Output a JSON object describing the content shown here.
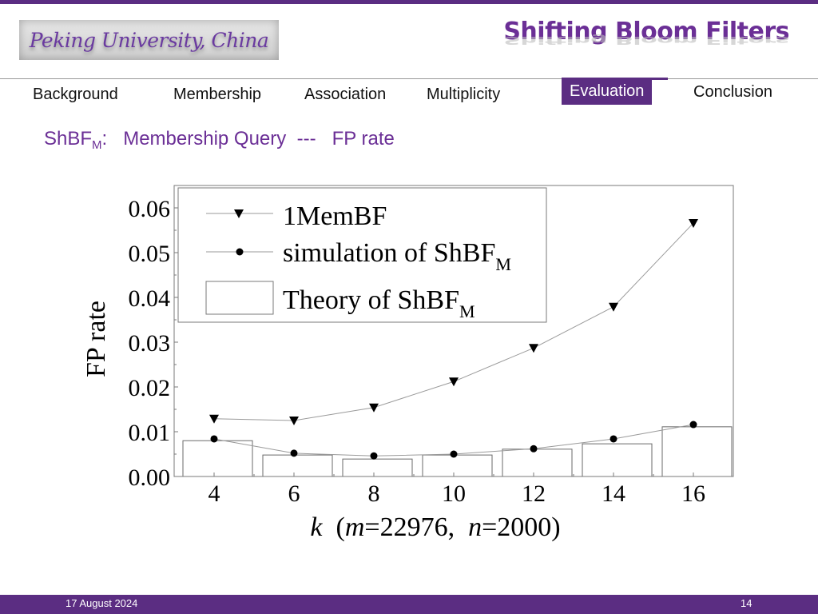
{
  "header": {
    "logo_text": "Peking University, China",
    "deck_title": "Shifting Bloom Filters"
  },
  "nav": {
    "items": [
      {
        "label": "Background",
        "active": false
      },
      {
        "label": "Membership",
        "active": false
      },
      {
        "label": "Association",
        "active": false
      },
      {
        "label": "Multiplicity",
        "active": false
      },
      {
        "label": "Evaluation",
        "active": true
      },
      {
        "label": "Conclusion",
        "active": false
      }
    ]
  },
  "slide": {
    "subtitle_prefix": "ShBF",
    "subtitle_sub": "M",
    "subtitle_rest": ":   Membership Query  ---   FP rate"
  },
  "colors": {
    "brand_purple": "#5b2d82",
    "title_purple": "#6b2f96"
  },
  "chart_data": {
    "type": "bar+line",
    "title": "",
    "xlabel": "k  (m=22976,  n=2000)",
    "xlabel_parts": {
      "k": "k",
      "open": "  (",
      "m": "m",
      "m_val": "=22976,  ",
      "n": "n",
      "n_val": "=2000)"
    },
    "ylabel": "FP rate",
    "categories": [
      4,
      6,
      8,
      10,
      12,
      14,
      16
    ],
    "x_ticks": [
      "4",
      "6",
      "8",
      "10",
      "12",
      "14",
      "16"
    ],
    "y_ticks": [
      "0.00",
      "0.01",
      "0.02",
      "0.03",
      "0.04",
      "0.05",
      "0.06"
    ],
    "ylim": [
      0,
      0.064
    ],
    "xlim": [
      3,
      17
    ],
    "grid": false,
    "legend_position": "top-left",
    "series": [
      {
        "name": "1MemBF",
        "name_main": "1MemBF",
        "name_sub": "",
        "type": "line",
        "marker": "triangle-down",
        "values": [
          0.0129,
          0.0125,
          0.0154,
          0.0212,
          0.0287,
          0.0379,
          0.0566
        ]
      },
      {
        "name": "simulation of ShBF_M",
        "name_main": "simulation of ShBF",
        "name_sub": "M",
        "type": "line",
        "marker": "circle",
        "values": [
          0.0084,
          0.0052,
          0.0046,
          0.005,
          0.0062,
          0.0084,
          0.0116
        ]
      },
      {
        "name": "Theory of ShBF_M",
        "name_main": "Theory of ShBF",
        "name_sub": "M",
        "type": "bar",
        "marker": "none",
        "values": [
          0.008,
          0.0048,
          0.0039,
          0.0048,
          0.0061,
          0.0073,
          0.0111
        ]
      }
    ]
  },
  "footer": {
    "date": "17 August 2024",
    "page": "14"
  }
}
